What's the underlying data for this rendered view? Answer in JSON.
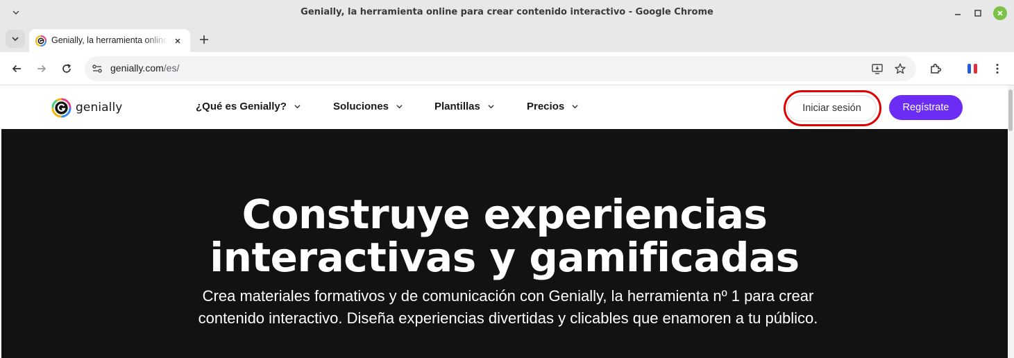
{
  "window": {
    "title": "Genially, la herramienta online para crear contenido interactivo - Google Chrome",
    "close_color": "#7cc247"
  },
  "tab": {
    "label": "Genially, la herramienta online para crear contenido interactivo",
    "favicon": "genially-logo-icon"
  },
  "omnibox": {
    "domain": "genially.com",
    "path": "/es/"
  },
  "site": {
    "logo_text": "genially",
    "nav": [
      {
        "label": "¿Qué es Genially?"
      },
      {
        "label": "Soluciones"
      },
      {
        "label": "Plantillas"
      },
      {
        "label": "Precios"
      }
    ],
    "login_label": "Iniciar sesión",
    "register_label": "Regístrate",
    "accent_color": "#6b2cf5",
    "highlight_color": "#e00000"
  },
  "hero": {
    "title_line1": "Construye experiencias",
    "title_line2": "interactivas y gamificadas",
    "subtitle": "Crea materiales formativos y de comunicación con Genially, la herramienta nº 1 para crear contenido interactivo. Diseña experiencias divertidas y clicables que enamoren a tu público.",
    "background": "#121212"
  }
}
